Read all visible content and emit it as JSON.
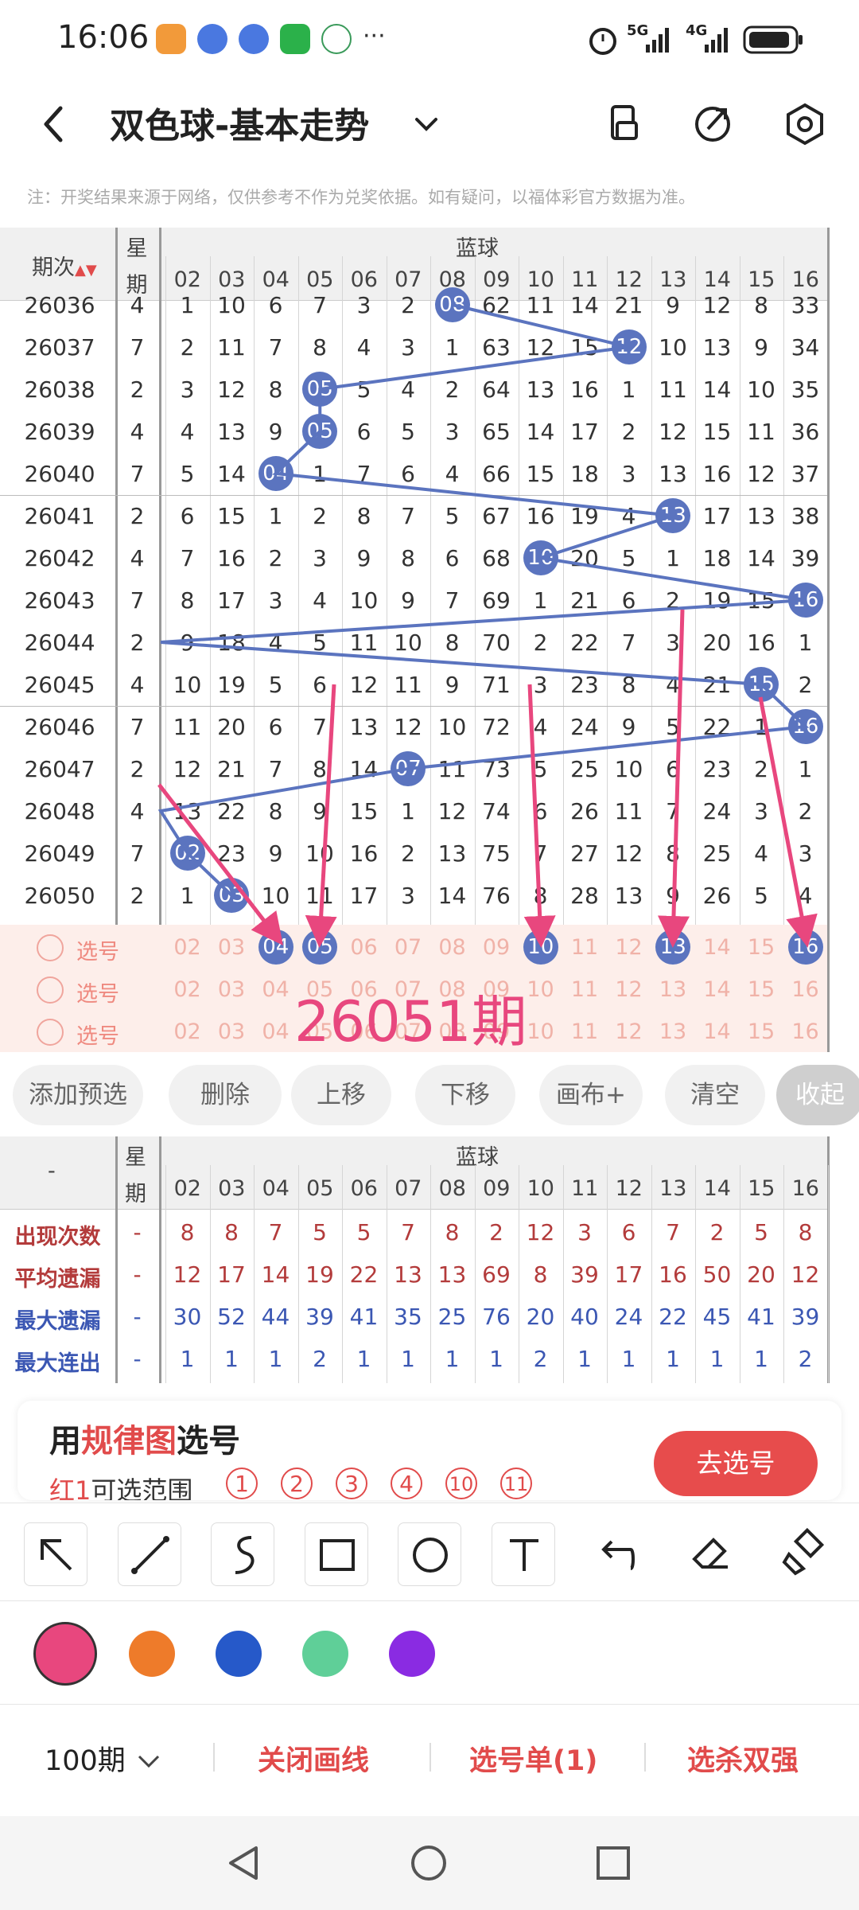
{
  "status_bar": {
    "time": "16:06",
    "network1": "5G",
    "network2": "4G",
    "more": "···"
  },
  "header": {
    "title": "双色球-基本走势"
  },
  "notice": "注：开奖结果来源于网络，仅供参考不作为兑奖依据。如有疑问，以福体彩官方数据为准。",
  "trend": {
    "col_issue": "期次",
    "col_week": [
      "星",
      "期"
    ],
    "blue_title": "蓝球",
    "numbers": [
      "02",
      "03",
      "04",
      "05",
      "06",
      "07",
      "08",
      "09",
      "10",
      "11",
      "12",
      "13",
      "14",
      "15",
      "16"
    ],
    "rows": [
      {
        "issue": "26036",
        "week": "4",
        "cells": [
          "1",
          "10",
          "6",
          "7",
          "3",
          "2",
          "08",
          "62",
          "11",
          "14",
          "21",
          "9",
          "12",
          "8",
          "33"
        ],
        "hit": 6
      },
      {
        "issue": "26037",
        "week": "7",
        "cells": [
          "2",
          "11",
          "7",
          "8",
          "4",
          "3",
          "1",
          "63",
          "12",
          "15",
          "12",
          "10",
          "13",
          "9",
          "34"
        ],
        "hit": 10
      },
      {
        "issue": "26038",
        "week": "2",
        "cells": [
          "3",
          "12",
          "8",
          "05",
          "5",
          "4",
          "2",
          "64",
          "13",
          "16",
          "1",
          "11",
          "14",
          "10",
          "35"
        ],
        "hit": 3
      },
      {
        "issue": "26039",
        "week": "4",
        "cells": [
          "4",
          "13",
          "9",
          "05",
          "6",
          "5",
          "3",
          "65",
          "14",
          "17",
          "2",
          "12",
          "15",
          "11",
          "36"
        ],
        "hit": 3
      },
      {
        "issue": "26040",
        "week": "7",
        "cells": [
          "5",
          "14",
          "04",
          "1",
          "7",
          "6",
          "4",
          "66",
          "15",
          "18",
          "3",
          "13",
          "16",
          "12",
          "37"
        ],
        "hit": 2
      },
      {
        "issue": "26041",
        "week": "2",
        "cells": [
          "6",
          "15",
          "1",
          "2",
          "8",
          "7",
          "5",
          "67",
          "16",
          "19",
          "4",
          "13",
          "17",
          "13",
          "38"
        ],
        "hit": 11
      },
      {
        "issue": "26042",
        "week": "4",
        "cells": [
          "7",
          "16",
          "2",
          "3",
          "9",
          "8",
          "6",
          "68",
          "10",
          "20",
          "5",
          "1",
          "18",
          "14",
          "39"
        ],
        "hit": 8
      },
      {
        "issue": "26043",
        "week": "7",
        "cells": [
          "8",
          "17",
          "3",
          "4",
          "10",
          "9",
          "7",
          "69",
          "1",
          "21",
          "6",
          "2",
          "19",
          "15",
          "16"
        ],
        "hit": 14
      },
      {
        "issue": "26044",
        "week": "2",
        "cells": [
          "9",
          "18",
          "4",
          "5",
          "11",
          "10",
          "8",
          "70",
          "2",
          "22",
          "7",
          "3",
          "20",
          "16",
          "1"
        ],
        "hit": -1
      },
      {
        "issue": "26045",
        "week": "4",
        "cells": [
          "10",
          "19",
          "5",
          "6",
          "12",
          "11",
          "9",
          "71",
          "3",
          "23",
          "8",
          "4",
          "21",
          "15",
          "2"
        ],
        "hit": 13
      },
      {
        "issue": "26046",
        "week": "7",
        "cells": [
          "11",
          "20",
          "6",
          "7",
          "13",
          "12",
          "10",
          "72",
          "4",
          "24",
          "9",
          "5",
          "22",
          "1",
          "16"
        ],
        "hit": 14
      },
      {
        "issue": "26047",
        "week": "2",
        "cells": [
          "12",
          "21",
          "7",
          "8",
          "14",
          "07",
          "11",
          "73",
          "5",
          "25",
          "10",
          "6",
          "23",
          "2",
          "1"
        ],
        "hit": 5
      },
      {
        "issue": "26048",
        "week": "4",
        "cells": [
          "13",
          "22",
          "8",
          "9",
          "15",
          "1",
          "12",
          "74",
          "6",
          "26",
          "11",
          "7",
          "24",
          "3",
          "2"
        ],
        "hit": -1
      },
      {
        "issue": "26049",
        "week": "7",
        "cells": [
          "02",
          "23",
          "9",
          "10",
          "16",
          "2",
          "13",
          "75",
          "7",
          "27",
          "12",
          "8",
          "25",
          "4",
          "3"
        ],
        "hit": 0
      },
      {
        "issue": "26050",
        "week": "2",
        "cells": [
          "1",
          "03",
          "10",
          "11",
          "17",
          "3",
          "14",
          "76",
          "8",
          "28",
          "13",
          "9",
          "26",
          "5",
          "4"
        ],
        "hit": 1
      }
    ]
  },
  "pick": {
    "label": "选号",
    "numbers": [
      "02",
      "03",
      "04",
      "05",
      "06",
      "07",
      "08",
      "09",
      "10",
      "11",
      "12",
      "13",
      "14",
      "15",
      "16"
    ],
    "selected": [
      "04",
      "05",
      "10",
      "13",
      "16"
    ],
    "annotation": "26051期"
  },
  "buttons": [
    "添加预选",
    "删除",
    "上移",
    "下移",
    "画布+",
    "清空",
    "收起"
  ],
  "stats": {
    "rows": [
      {
        "label": "出现次数",
        "color": "#b33b3b",
        "dash": "-",
        "values": [
          "8",
          "8",
          "7",
          "5",
          "5",
          "7",
          "8",
          "2",
          "12",
          "3",
          "6",
          "7",
          "2",
          "5",
          "8"
        ]
      },
      {
        "label": "平均遗漏",
        "color": "#b33b3b",
        "dash": "-",
        "values": [
          "12",
          "17",
          "14",
          "19",
          "22",
          "13",
          "13",
          "69",
          "8",
          "39",
          "17",
          "16",
          "50",
          "20",
          "12"
        ]
      },
      {
        "label": "最大遗漏",
        "color": "#3b57b3",
        "dash": "-",
        "values": [
          "30",
          "52",
          "44",
          "39",
          "41",
          "35",
          "25",
          "76",
          "20",
          "40",
          "24",
          "22",
          "45",
          "41",
          "39"
        ]
      },
      {
        "label": "最大连出",
        "color": "#3b57b3",
        "dash": "-",
        "values": [
          "1",
          "1",
          "1",
          "2",
          "1",
          "1",
          "1",
          "1",
          "2",
          "1",
          "1",
          "1",
          "1",
          "1",
          "2"
        ]
      }
    ],
    "corner": "-"
  },
  "card": {
    "title_pre": "用",
    "title_hl": "规律图",
    "title_post": "选号",
    "sub_hl": "红1",
    "sub_post": "可选范围",
    "range": [
      "1",
      "2",
      "3",
      "4",
      "10",
      "11"
    ],
    "button": "去选号"
  },
  "tools": [
    "arrow-icon",
    "line-icon",
    "freehand-icon",
    "rectangle-icon",
    "circle-icon",
    "text-icon",
    "undo-icon",
    "eraser-icon",
    "clear-brush-icon"
  ],
  "colors": [
    "#e8477e",
    "#ee7b2a",
    "#2659c9",
    "#5fcf98",
    "#8a2be2"
  ],
  "bottom": {
    "periods": "100期",
    "close_draw": "关闭画线",
    "pick_list": "选号单(1)",
    "kill": "选杀双强"
  }
}
